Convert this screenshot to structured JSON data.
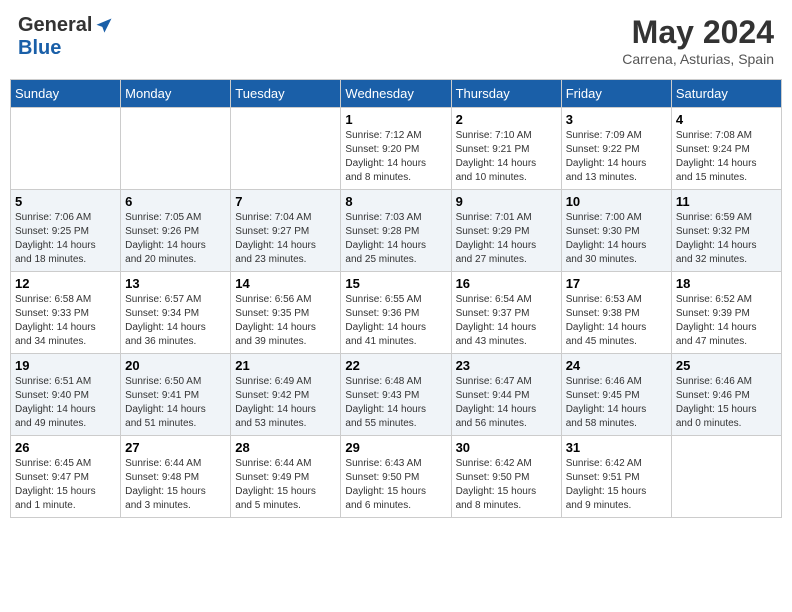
{
  "header": {
    "logo_general": "General",
    "logo_blue": "Blue",
    "month_year": "May 2024",
    "location": "Carrena, Asturias, Spain"
  },
  "weekdays": [
    "Sunday",
    "Monday",
    "Tuesday",
    "Wednesday",
    "Thursday",
    "Friday",
    "Saturday"
  ],
  "weeks": [
    [
      {
        "day": "",
        "info": ""
      },
      {
        "day": "",
        "info": ""
      },
      {
        "day": "",
        "info": ""
      },
      {
        "day": "1",
        "info": "Sunrise: 7:12 AM\nSunset: 9:20 PM\nDaylight: 14 hours\nand 8 minutes."
      },
      {
        "day": "2",
        "info": "Sunrise: 7:10 AM\nSunset: 9:21 PM\nDaylight: 14 hours\nand 10 minutes."
      },
      {
        "day": "3",
        "info": "Sunrise: 7:09 AM\nSunset: 9:22 PM\nDaylight: 14 hours\nand 13 minutes."
      },
      {
        "day": "4",
        "info": "Sunrise: 7:08 AM\nSunset: 9:24 PM\nDaylight: 14 hours\nand 15 minutes."
      }
    ],
    [
      {
        "day": "5",
        "info": "Sunrise: 7:06 AM\nSunset: 9:25 PM\nDaylight: 14 hours\nand 18 minutes."
      },
      {
        "day": "6",
        "info": "Sunrise: 7:05 AM\nSunset: 9:26 PM\nDaylight: 14 hours\nand 20 minutes."
      },
      {
        "day": "7",
        "info": "Sunrise: 7:04 AM\nSunset: 9:27 PM\nDaylight: 14 hours\nand 23 minutes."
      },
      {
        "day": "8",
        "info": "Sunrise: 7:03 AM\nSunset: 9:28 PM\nDaylight: 14 hours\nand 25 minutes."
      },
      {
        "day": "9",
        "info": "Sunrise: 7:01 AM\nSunset: 9:29 PM\nDaylight: 14 hours\nand 27 minutes."
      },
      {
        "day": "10",
        "info": "Sunrise: 7:00 AM\nSunset: 9:30 PM\nDaylight: 14 hours\nand 30 minutes."
      },
      {
        "day": "11",
        "info": "Sunrise: 6:59 AM\nSunset: 9:32 PM\nDaylight: 14 hours\nand 32 minutes."
      }
    ],
    [
      {
        "day": "12",
        "info": "Sunrise: 6:58 AM\nSunset: 9:33 PM\nDaylight: 14 hours\nand 34 minutes."
      },
      {
        "day": "13",
        "info": "Sunrise: 6:57 AM\nSunset: 9:34 PM\nDaylight: 14 hours\nand 36 minutes."
      },
      {
        "day": "14",
        "info": "Sunrise: 6:56 AM\nSunset: 9:35 PM\nDaylight: 14 hours\nand 39 minutes."
      },
      {
        "day": "15",
        "info": "Sunrise: 6:55 AM\nSunset: 9:36 PM\nDaylight: 14 hours\nand 41 minutes."
      },
      {
        "day": "16",
        "info": "Sunrise: 6:54 AM\nSunset: 9:37 PM\nDaylight: 14 hours\nand 43 minutes."
      },
      {
        "day": "17",
        "info": "Sunrise: 6:53 AM\nSunset: 9:38 PM\nDaylight: 14 hours\nand 45 minutes."
      },
      {
        "day": "18",
        "info": "Sunrise: 6:52 AM\nSunset: 9:39 PM\nDaylight: 14 hours\nand 47 minutes."
      }
    ],
    [
      {
        "day": "19",
        "info": "Sunrise: 6:51 AM\nSunset: 9:40 PM\nDaylight: 14 hours\nand 49 minutes."
      },
      {
        "day": "20",
        "info": "Sunrise: 6:50 AM\nSunset: 9:41 PM\nDaylight: 14 hours\nand 51 minutes."
      },
      {
        "day": "21",
        "info": "Sunrise: 6:49 AM\nSunset: 9:42 PM\nDaylight: 14 hours\nand 53 minutes."
      },
      {
        "day": "22",
        "info": "Sunrise: 6:48 AM\nSunset: 9:43 PM\nDaylight: 14 hours\nand 55 minutes."
      },
      {
        "day": "23",
        "info": "Sunrise: 6:47 AM\nSunset: 9:44 PM\nDaylight: 14 hours\nand 56 minutes."
      },
      {
        "day": "24",
        "info": "Sunrise: 6:46 AM\nSunset: 9:45 PM\nDaylight: 14 hours\nand 58 minutes."
      },
      {
        "day": "25",
        "info": "Sunrise: 6:46 AM\nSunset: 9:46 PM\nDaylight: 15 hours\nand 0 minutes."
      }
    ],
    [
      {
        "day": "26",
        "info": "Sunrise: 6:45 AM\nSunset: 9:47 PM\nDaylight: 15 hours\nand 1 minute."
      },
      {
        "day": "27",
        "info": "Sunrise: 6:44 AM\nSunset: 9:48 PM\nDaylight: 15 hours\nand 3 minutes."
      },
      {
        "day": "28",
        "info": "Sunrise: 6:44 AM\nSunset: 9:49 PM\nDaylight: 15 hours\nand 5 minutes."
      },
      {
        "day": "29",
        "info": "Sunrise: 6:43 AM\nSunset: 9:50 PM\nDaylight: 15 hours\nand 6 minutes."
      },
      {
        "day": "30",
        "info": "Sunrise: 6:42 AM\nSunset: 9:50 PM\nDaylight: 15 hours\nand 8 minutes."
      },
      {
        "day": "31",
        "info": "Sunrise: 6:42 AM\nSunset: 9:51 PM\nDaylight: 15 hours\nand 9 minutes."
      },
      {
        "day": "",
        "info": ""
      }
    ]
  ]
}
